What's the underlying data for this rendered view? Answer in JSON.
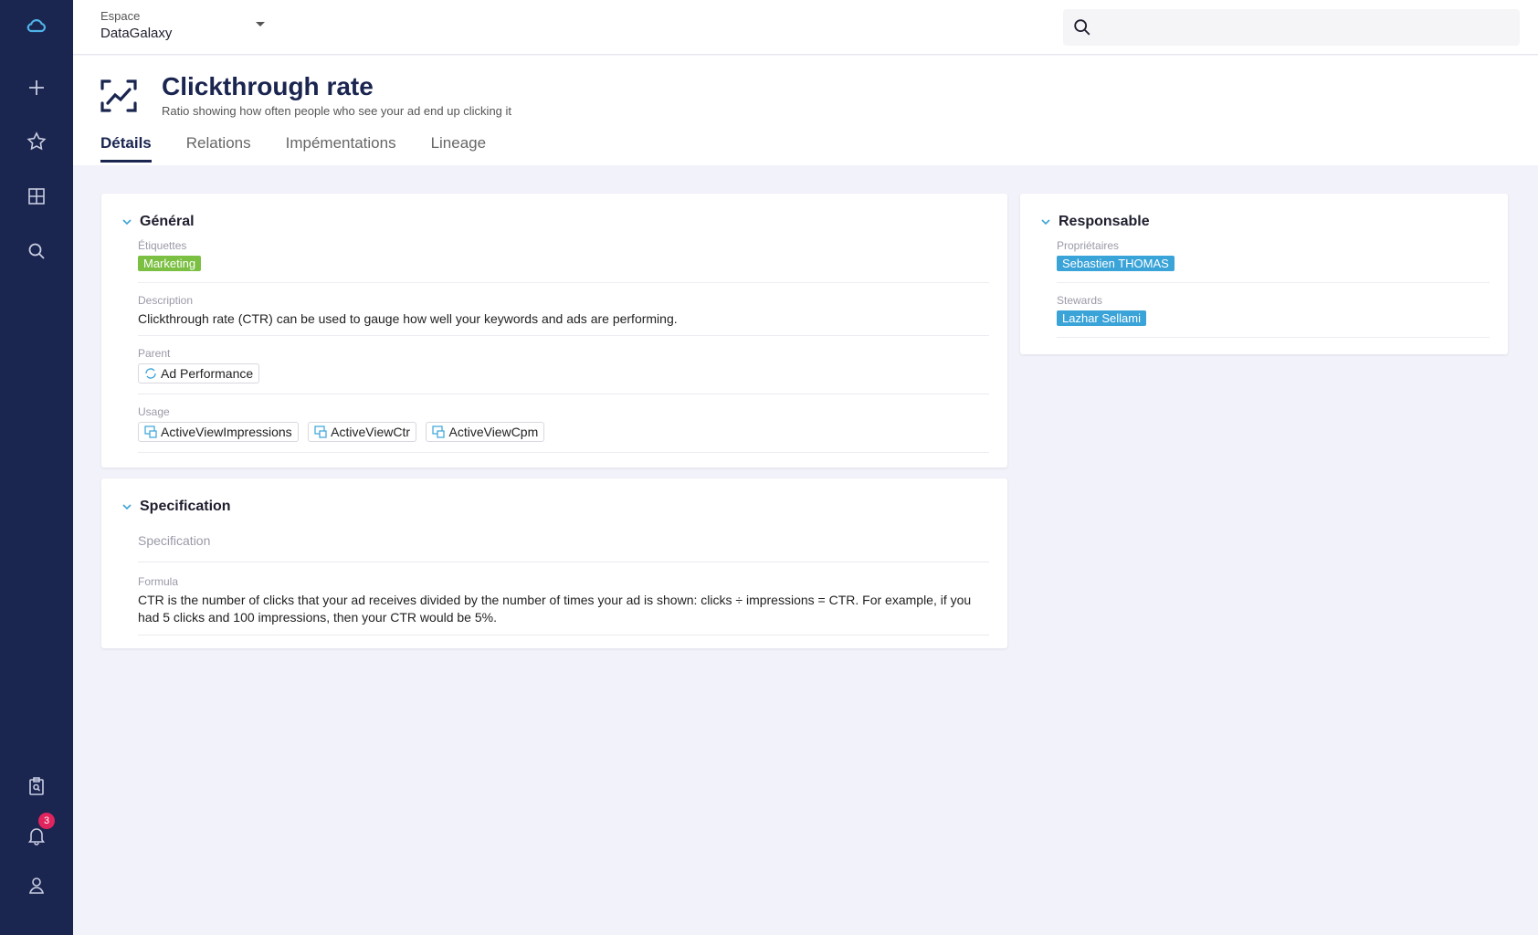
{
  "app": {
    "name": "DataGalaxy"
  },
  "topbar": {
    "space_label": "Espace",
    "space_value": "DataGalaxy",
    "search_placeholder": ""
  },
  "sidebar": {
    "icons": [
      "cloud-logo-icon",
      "plus-icon",
      "star-icon",
      "grid-icon",
      "search-icon",
      "clipboard-search-icon",
      "bell-icon",
      "user-icon"
    ],
    "notification_count": "3"
  },
  "object": {
    "title": "Clickthrough rate",
    "description": "Ratio showing how often people who see your ad end up clicking it",
    "icon": "kpi-icon"
  },
  "tabs": [
    {
      "label": "Détails",
      "active": true
    },
    {
      "label": "Relations",
      "active": false
    },
    {
      "label": "Impémentations",
      "active": false
    },
    {
      "label": "Lineage",
      "active": false
    }
  ],
  "general": {
    "title": "Général",
    "tags_label": "Étiquettes",
    "tags": [
      {
        "label": "Marketing",
        "color": "#7cc043"
      }
    ],
    "description_label": "Description",
    "description_value": "Clickthrough rate (CTR) can be used to gauge how well your keywords and ads are performing.",
    "parent_label": "Parent",
    "parent_value": "Ad Performance",
    "usage_label": "Usage",
    "usage": [
      "ActiveViewImpressions",
      "ActiveViewCtr",
      "ActiveViewCpm"
    ]
  },
  "specification": {
    "title": "Specification",
    "spec_placeholder": "Specification",
    "formula_label": "Formula",
    "formula_value": "CTR is the number of clicks that your ad receives divided by the number of times your ad is shown: clicks ÷ impressions = CTR. For example, if you had 5 clicks and 100 impressions, then your CTR would be 5%."
  },
  "responsable": {
    "title": "Responsable",
    "owners_label": "Propriétaires",
    "owners": [
      {
        "label": "Sebastien THOMAS",
        "color": "#3aa3d8"
      }
    ],
    "stewards_label": "Stewards",
    "stewards": [
      {
        "label": "Lazhar Sellami",
        "color": "#3aa3d8"
      }
    ]
  },
  "colors": {
    "sidebar_bg": "#1a2550",
    "accent": "#1a2550",
    "logo": "#4fb3e8"
  }
}
